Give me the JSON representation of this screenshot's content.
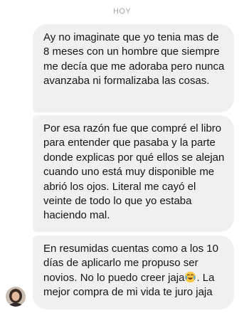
{
  "conversation": {
    "day_label": "HOY",
    "messages": [
      {
        "text": "Ay no imaginate que yo tenia mas de 8 meses con un hombre que siempre me decía que me adoraba pero nunca avanzaba ni formalizaba las cosas."
      },
      {
        "text": "Por esa razón fue que compré el libro para entender que pasaba y la parte donde explicas por qué ellos se alejan cuando uno está muy disponible me abrió los ojos. Literal me cayó el veinte de todo lo que yo estaba haciendo mal."
      },
      {
        "text_before_emoji": "En resumidas cuentas como a los 10 días de aplicarlo me propuso ser novios. No lo puedo creer jaja",
        "emoji": "crying-laughing-emoji",
        "text_after_emoji": ". La mejor compra de mi vida te juro jaja"
      }
    ],
    "sender_avatar": "profile-photo"
  }
}
